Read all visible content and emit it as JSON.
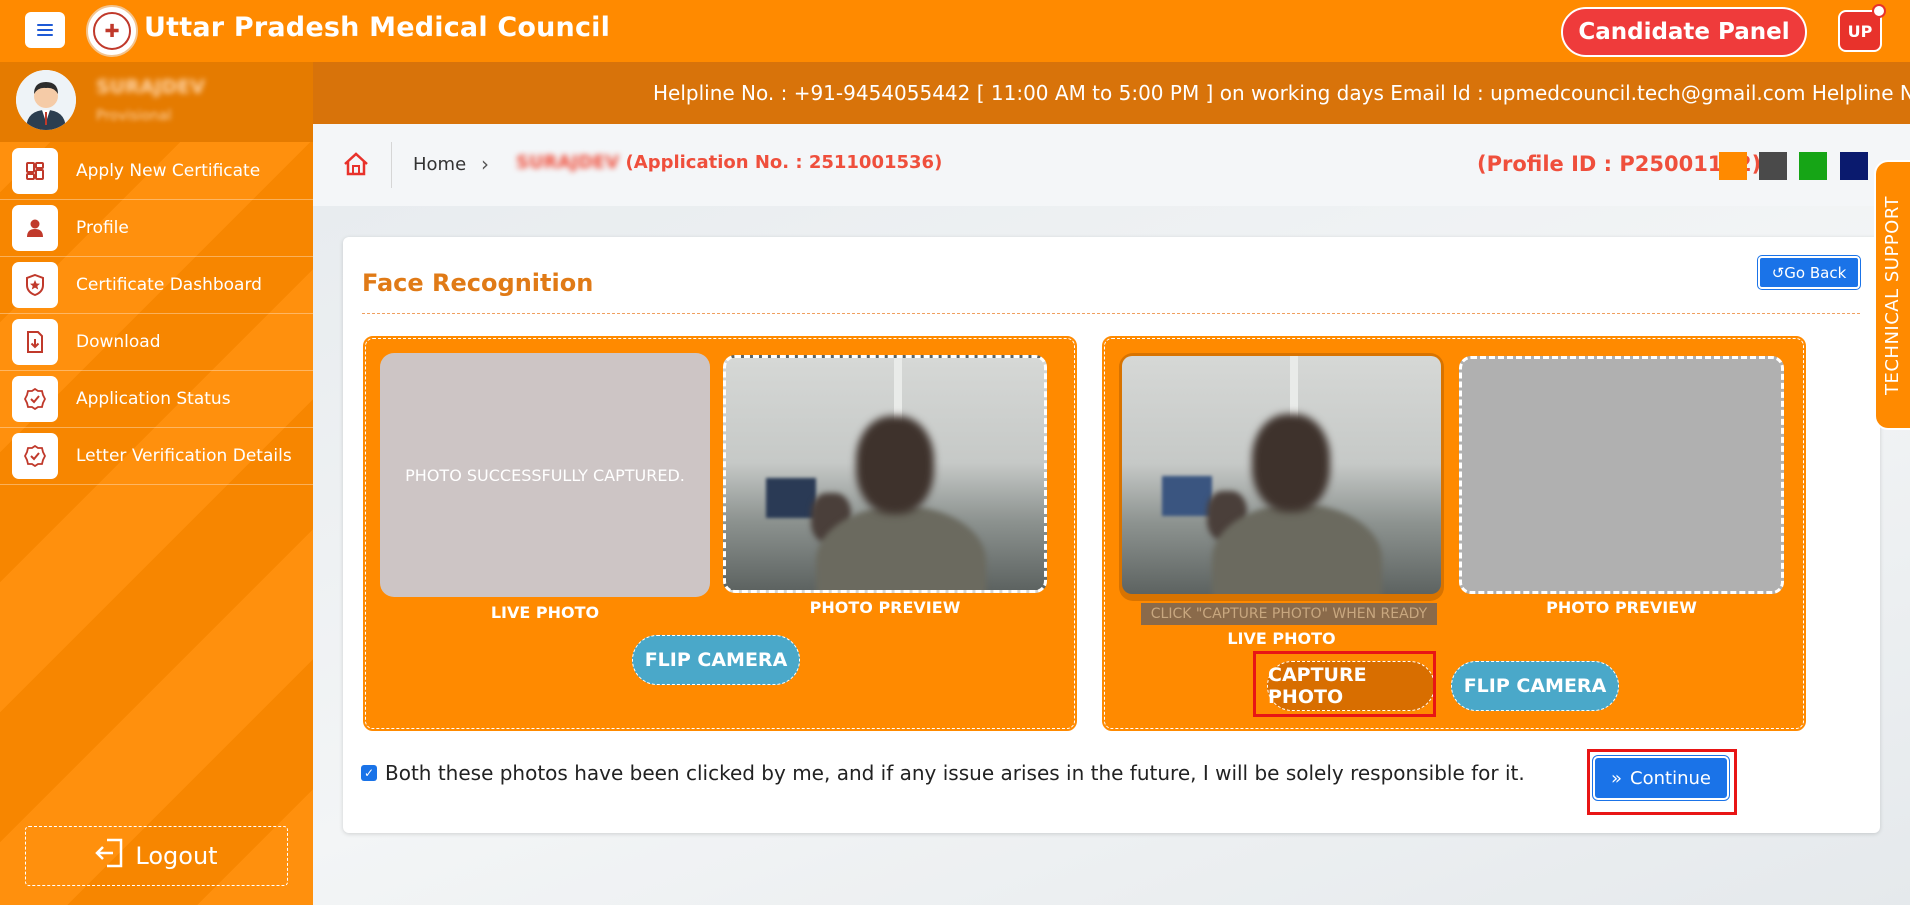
{
  "header": {
    "title": "Uttar Pradesh Medical Council",
    "candidate_panel_label": "Candidate Panel",
    "user_badge": "UP"
  },
  "sidebar": {
    "user": {
      "name": "SURAJDEV",
      "role": "Provisional"
    },
    "items": [
      {
        "label": "Apply New Certificate",
        "icon": "dashboard-grid-icon"
      },
      {
        "label": "Profile",
        "icon": "user-icon"
      },
      {
        "label": "Certificate Dashboard",
        "icon": "shield-star-icon"
      },
      {
        "label": "Download",
        "icon": "file-download-icon"
      },
      {
        "label": "Application Status",
        "icon": "check-badge-icon"
      },
      {
        "label": "Letter Verification Details",
        "icon": "check-badge-icon"
      }
    ],
    "logout_label": "Logout"
  },
  "infobar": {
    "text": "Helpline No. : +91-9454055442 [ 11:00 AM to 5:00 PM ] on working days   Email Id : upmedcouncil.tech@gmail.com  Helpline No."
  },
  "breadcrumb": {
    "home": "Home",
    "applicant_name": "SURAJDEV",
    "application_label": "(Application No. : 2511001536)",
    "profile_id": "(Profile ID : P25001122)",
    "theme_colors": [
      "#ff8a00",
      "#4a4a4a",
      "#16a516",
      "#0a1a6e"
    ]
  },
  "card": {
    "title": "Face Recognition",
    "go_back_label": "Go Back",
    "left_panel": {
      "captured_message": "PHOTO SUCCESSFULLY CAPTURED.",
      "live_label": "LIVE PHOTO",
      "preview_label": "PHOTO PREVIEW",
      "flip_label": "FLIP CAMERA"
    },
    "right_panel": {
      "ready_message": "CLICK \"CAPTURE PHOTO\" WHEN READY",
      "live_label": "LIVE PHOTO",
      "preview_label": "PHOTO PREVIEW",
      "capture_label": "CAPTURE PHOTO",
      "flip_label": "FLIP CAMERA"
    },
    "consent_text": "Both these photos have been clicked by me, and if any issue arises in the future, I will be solely responsible for it.",
    "consent_checked": true,
    "continue_label": "Continue"
  },
  "tech_support_label": "TECHNICAL SUPPORT",
  "colors": {
    "primary_orange": "#ff8a00",
    "accent_red": "#ef3b3b",
    "button_blue": "#1a73e8",
    "highlight_red": "#e81515"
  }
}
